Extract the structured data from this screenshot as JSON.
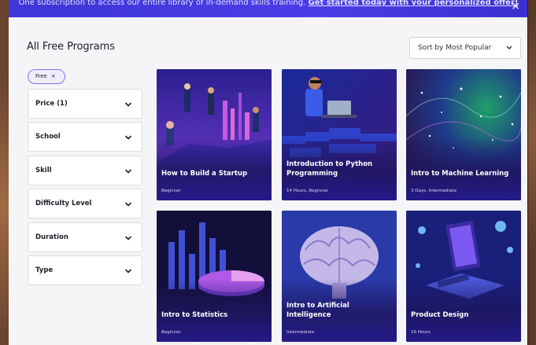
{
  "banner": {
    "text": "One subscription to access our entire library of in-demand skills training.",
    "cta": "Get started today with your personalized offer!",
    "close_glyph": "×"
  },
  "page_title": "All Free Programs",
  "sort": {
    "label": "Sort by Most Popular",
    "icon": "chevron-down-icon"
  },
  "active_filter_chip": {
    "label": "Free",
    "remove_glyph": "×"
  },
  "filters": [
    {
      "label": "Price (1)",
      "icon": "chevron-down-icon"
    },
    {
      "label": "School",
      "icon": "chevron-down-icon"
    },
    {
      "label": "Skill",
      "icon": "chevron-down-icon"
    },
    {
      "label": "Difficulty Level",
      "icon": "chevron-down-icon"
    },
    {
      "label": "Duration",
      "icon": "chevron-down-icon"
    },
    {
      "label": "Type",
      "icon": "chevron-down-icon"
    }
  ],
  "programs": [
    {
      "title": "How to Build a Startup",
      "meta": "Beginner"
    },
    {
      "title": "Introduction to Python Programming",
      "meta": "14 Hours, Beginner"
    },
    {
      "title": "Intro to Machine Learning",
      "meta": "3 Days, Intermediate"
    },
    {
      "title": "Intro to Statistics",
      "meta": "Beginner"
    },
    {
      "title": "Intro to Artificial Intelligence",
      "meta": "Intermediate"
    },
    {
      "title": "Product Design",
      "meta": "16 Hours"
    }
  ],
  "colors": {
    "banner": "#3d36d8",
    "chip_border": "#7b74e8",
    "card_overlay": "#241a8a",
    "page_bg": "#f5f5f7"
  }
}
